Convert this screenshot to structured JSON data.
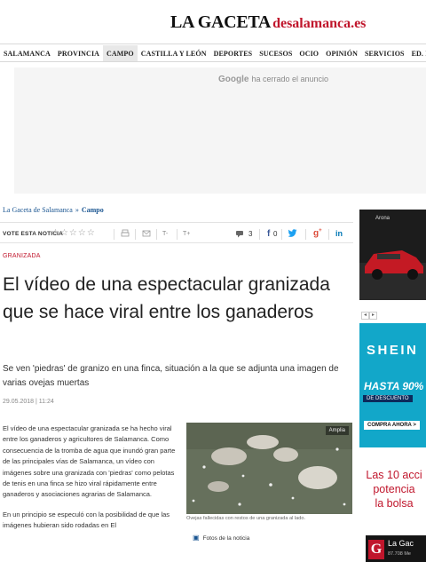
{
  "masthead": {
    "logo_main": "LA GACETA",
    "logo_sub": "desalamanca.es"
  },
  "nav": {
    "items": [
      "SALAMANCA",
      "PROVINCIA",
      "CAMPO",
      "CASTILLA Y LEÓN",
      "DEPORTES",
      "SUCESOS",
      "OCIO",
      "OPINIÓN",
      "SERVICIOS",
      "ED. IM"
    ],
    "active": "CAMPO"
  },
  "ad_notice": {
    "brand": "Google",
    "text": "ha cerrado el anuncio"
  },
  "breadcrumb": {
    "home": "La Gaceta de Salamanca",
    "separator": "»",
    "current": "Campo"
  },
  "toolbar": {
    "vote_label": "VOTE ESTA NOTICIA",
    "stars": "☆☆☆☆☆",
    "font_down": "T-",
    "font_up": "T+",
    "share_count": "3",
    "facebook_count": "0"
  },
  "article": {
    "kicker": "GRANIZADA",
    "headline": "El vídeo de una espectacular granizada que se hace viral entre los ganaderos",
    "subhead": "Se ven 'piedras' de granizo en una finca, situación a la que se adjunta una imagen de varias ovejas muertas",
    "date": "29.05.2018 | 11:24",
    "paragraphs": [
      "El vídeo de una espectacular granizada se ha hecho viral entre los ganaderos y agricultores de Salamanca. Como consecuencia de la tromba de agua que inundó gran parte de las principales vías de Salamanca, un vídeo con imágenes sobre una granizada con 'piedras' como pelotas de tenis en una finca se hizo viral rápidamente entre ganaderos y asociaciones agrarias de Salamanca.",
      "En un principio se especuló con la posibilidad de que las imágenes hubieran sido rodadas en El"
    ],
    "photo_enlarge": "Amplia",
    "photo_caption": "Ovejas fallecidas con restos de una granizada al lado.",
    "photos_link": "Fotos de la noticia"
  },
  "ads": {
    "car_brand": "Arona",
    "shein_logo": "SHEIN",
    "shein_offer": "HASTA 90%",
    "shein_desc": "DE DESCUENTO",
    "shein_cta": "COMPRA AHORA >",
    "promo_lines": [
      "Las 10 acci",
      "potencia",
      "la bolsa"
    ],
    "bottom_title": "La Gac",
    "bottom_sub": "87.708 Me"
  },
  "colors": {
    "brand_red": "#c0162c",
    "link_blue": "#1a5591",
    "shein_blue": "#12a7c9"
  }
}
